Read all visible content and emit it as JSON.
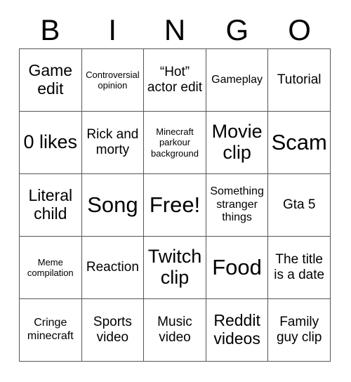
{
  "card": {
    "title_letters": [
      "B",
      "I",
      "N",
      "G",
      "O"
    ],
    "columns": 5,
    "rows": 5,
    "border_color": "#555555",
    "text_color": "#000000",
    "background_color": "#ffffff",
    "cells": [
      [
        {
          "text": "Game edit",
          "size": "lg"
        },
        {
          "text": "Controversial opinion",
          "size": "xs"
        },
        {
          "text": "“Hot” actor edit",
          "size": "md"
        },
        {
          "text": "Gameplay",
          "size": "sm"
        },
        {
          "text": "Tutorial",
          "size": "md"
        }
      ],
      [
        {
          "text": "0 likes",
          "size": "xl"
        },
        {
          "text": "Rick and morty",
          "size": "md"
        },
        {
          "text": "Minecraft parkour background",
          "size": "xs"
        },
        {
          "text": "Movie clip",
          "size": "xl"
        },
        {
          "text": "Scam",
          "size": "xxl"
        }
      ],
      [
        {
          "text": "Literal child",
          "size": "lg"
        },
        {
          "text": "Song",
          "size": "xxl"
        },
        {
          "text": "Free!",
          "size": "xxl"
        },
        {
          "text": "Something stranger things",
          "size": "sm"
        },
        {
          "text": "Gta 5",
          "size": "md"
        }
      ],
      [
        {
          "text": "Meme compilation",
          "size": "xs"
        },
        {
          "text": "Reaction",
          "size": "md"
        },
        {
          "text": "Twitch clip",
          "size": "xl"
        },
        {
          "text": "Food",
          "size": "xxl"
        },
        {
          "text": "The title is a date",
          "size": "md"
        }
      ],
      [
        {
          "text": "Cringe minecraft",
          "size": "sm"
        },
        {
          "text": "Sports video",
          "size": "md"
        },
        {
          "text": "Music video",
          "size": "md"
        },
        {
          "text": "Reddit videos",
          "size": "lg"
        },
        {
          "text": "Family guy clip",
          "size": "md"
        }
      ]
    ]
  }
}
